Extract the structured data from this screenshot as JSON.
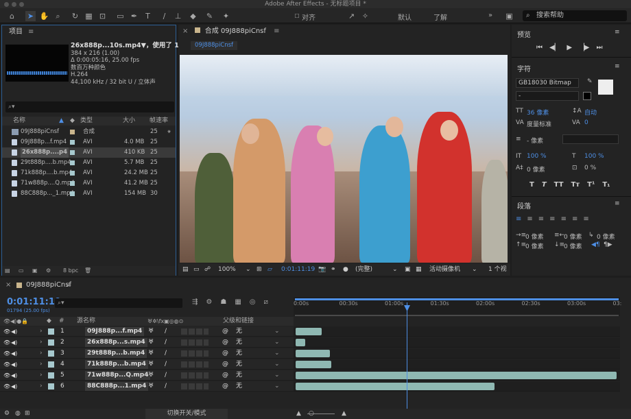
{
  "app": {
    "title": "Adobe After Effects - 无标题项目 *"
  },
  "toolbar": {
    "align_label": "对齐",
    "workspace_default": "默认",
    "workspace_learn": "了解",
    "more": "»",
    "search_placeholder": "搜索帮助"
  },
  "project": {
    "panel_title": "项目",
    "selected_name": "26x888p...10s.mp4▼，使用了 1 次",
    "info": [
      "384 x 216 (1.00)",
      "Δ 0:00:05:16, 25.00 fps",
      "数百万种颜色",
      "H.264",
      "44,100 kHz / 32 bit U / 立体声"
    ],
    "columns": [
      "名称",
      "类型",
      "大小",
      "帧速率"
    ],
    "items": [
      {
        "name": "09J888piCnsf",
        "type": "合成",
        "size": "",
        "fps": "25"
      },
      {
        "name": "09J888p...f.mp4",
        "type": "AVI",
        "size": "4.0 MB",
        "fps": "25"
      },
      {
        "name": "26x888p....p4",
        "type": "AVI",
        "size": "410 KB",
        "fps": "25"
      },
      {
        "name": "29t888p....b.mp4",
        "type": "AVI",
        "size": "5.7 MB",
        "fps": "25"
      },
      {
        "name": "71k888p....b.mp4",
        "type": "AVI",
        "size": "24.2 MB",
        "fps": "25"
      },
      {
        "name": "71w888p....Q.mp4",
        "type": "AVI",
        "size": "41.2 MB",
        "fps": "25"
      },
      {
        "name": "88C888p..._1.mp4",
        "type": "AVI",
        "size": "154 MB",
        "fps": "30"
      }
    ],
    "bpc": "8 bpc"
  },
  "composition": {
    "panel_title": "合成 09J888piCnsf",
    "tab": "09J888piCnsf",
    "zoom": "100%",
    "timecode": "0:01:11:19",
    "quality": "(完整)",
    "camera": "活动摄像机",
    "views": "1 个视"
  },
  "preview": {
    "title": "预览"
  },
  "character": {
    "title": "字符",
    "font": "GB18030 Bitmap",
    "style": "-",
    "size": "36 像素",
    "leading": "自动",
    "kerning": "度量标准",
    "tracking": "0",
    "stroke": "- 像素",
    "vscale": "100 %",
    "hscale": "100 %",
    "baseline": "0 像素",
    "tsume": "0 %",
    "styles": [
      "T",
      "T",
      "TT",
      "Tт",
      "T¹",
      "T₁"
    ]
  },
  "paragraph": {
    "title": "段落",
    "indent_left": "0 像素",
    "indent_right": "0 像素",
    "first_line": "0 像素",
    "space_before": "0 像素",
    "space_after": "0 像素",
    "space_extra": "0 像素"
  },
  "timeline": {
    "tab": "09J888piCnsf",
    "timecode": "0:01:11:19",
    "fps_line": "01794 (25.00 fps)",
    "ticks": [
      "0:00s",
      "00:30s",
      "01:00s",
      "01:30s",
      "02:00s",
      "02:30s",
      "03:00s",
      "03:"
    ],
    "col_source": "源名称",
    "col_parent": "父级和链接",
    "layers": [
      {
        "num": "1",
        "name": "09J888p...f.mp4",
        "parent": "无"
      },
      {
        "num": "2",
        "name": "26x888p...s.mp4",
        "parent": "无"
      },
      {
        "num": "3",
        "name": "29t888p...b.mp4",
        "parent": "无"
      },
      {
        "num": "4",
        "name": "71k888p...b.mp4",
        "parent": "无"
      },
      {
        "num": "5",
        "name": "71w888p...Q.mp4",
        "parent": "无"
      },
      {
        "num": "6",
        "name": "88C888p...1.mp4",
        "parent": "无"
      }
    ],
    "footer_toggle": "切换开关/模式"
  }
}
